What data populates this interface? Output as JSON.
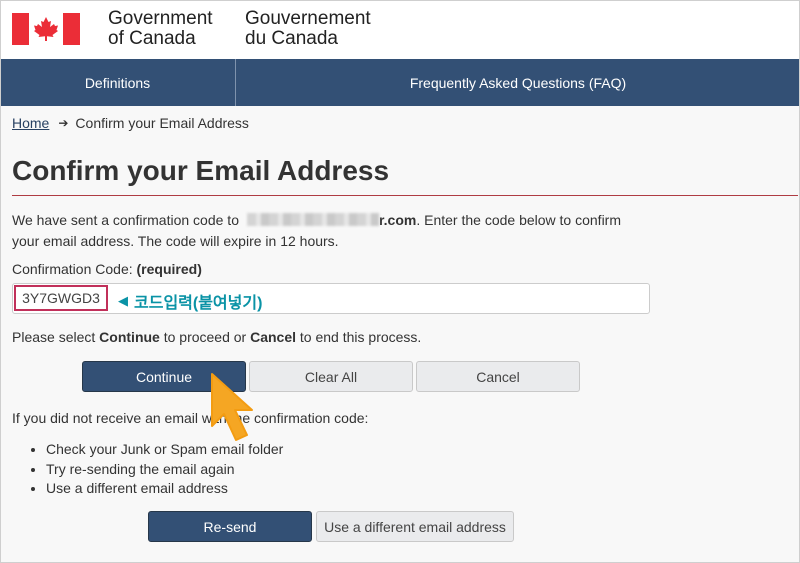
{
  "header": {
    "signature_en_line1": "Government",
    "signature_en_line2": "of Canada",
    "signature_fr_line1": "Gouvernement",
    "signature_fr_line2": "du Canada",
    "flag_icon": "canada-flag-icon"
  },
  "nav": {
    "items": [
      {
        "label": "Definitions"
      },
      {
        "label": "Frequently Asked Questions (FAQ)"
      }
    ]
  },
  "breadcrumb": {
    "home": "Home",
    "separator": "➔",
    "current": "Confirm your Email Address"
  },
  "page": {
    "title": "Confirm your Email Address",
    "intro_part1": "We have sent a confirmation code to",
    "intro_email_suffix": "r.com",
    "intro_part2": ". Enter the code below to confirm your email address. The code will expire in 12 hours.",
    "code_label": "Confirmation Code:",
    "code_required": "(required)",
    "code_value": "3Y7GWGD3",
    "annotation": "코드입력(붙여넣기)",
    "select_prefix": "Please select ",
    "select_continue": "Continue",
    "select_middle": " to proceed or ",
    "select_cancel": "Cancel",
    "select_suffix": " to end this process.",
    "no_email_notice": "If you did not receive an email with the confirmation code:",
    "tips": [
      "Check your Junk or Spam email folder",
      "Try re-sending the email again",
      "Use a different email address"
    ]
  },
  "buttons": {
    "continue": "Continue",
    "clear_all": "Clear All",
    "cancel": "Cancel",
    "resend": "Re-send",
    "different_email": "Use a different email address"
  },
  "colors": {
    "nav_bg": "#335075",
    "accent_rule": "#af3c43",
    "annotation": "#0a93a6",
    "code_box_border": "#c1305a",
    "cursor": "#f5a623"
  }
}
